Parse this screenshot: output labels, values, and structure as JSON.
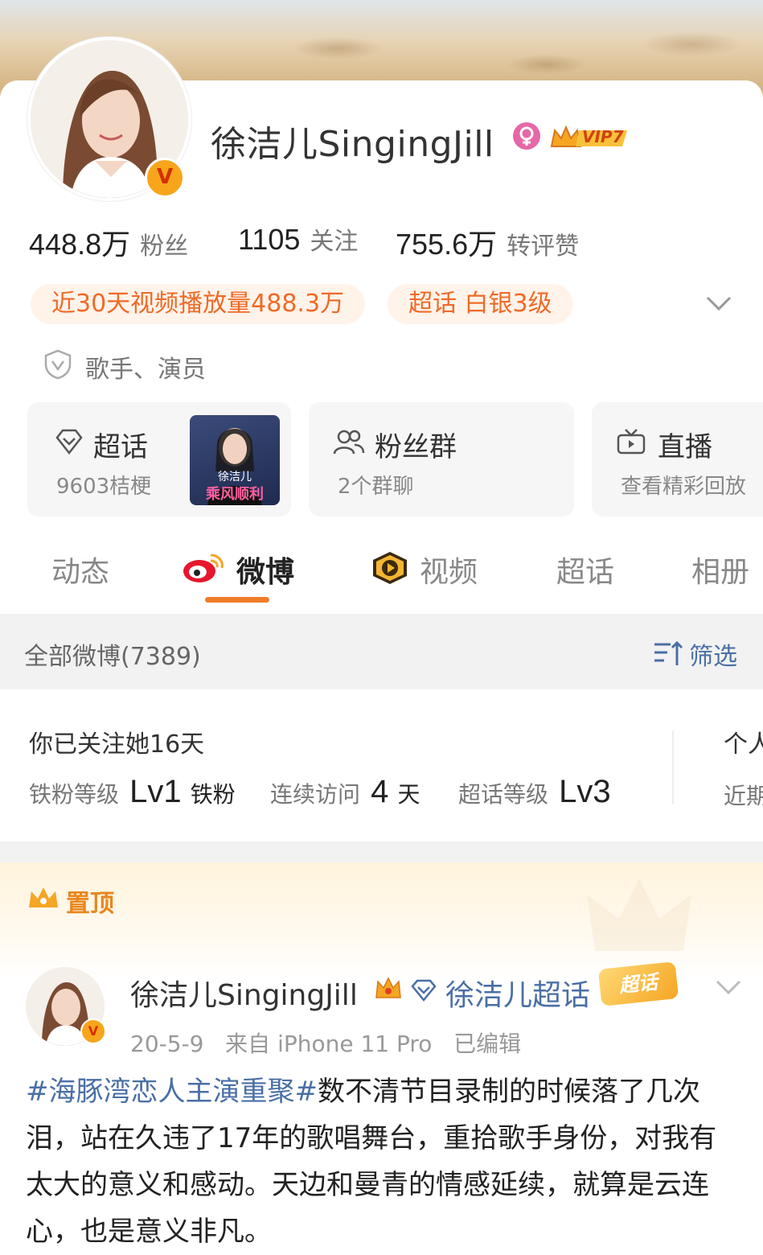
{
  "profile": {
    "name": "徐洁儿SingingJill",
    "vip_label": "VIP7",
    "stats": [
      {
        "value": "448.8万",
        "label": "粉丝"
      },
      {
        "value": "1105",
        "label": "关注"
      },
      {
        "value": "755.6万",
        "label": "转评赞"
      }
    ],
    "pills": [
      "近30天视频播放量488.3万",
      "超话 白银3级"
    ],
    "verified_text": "歌手、演员"
  },
  "entries": [
    {
      "title": "超话",
      "sub": "9603桔梗",
      "thumb_name": "徐洁儿",
      "thumb_caption": "乘风顺利"
    },
    {
      "title": "粉丝群",
      "sub": "2个群聊"
    },
    {
      "title": "直播",
      "sub": "查看精彩回放"
    }
  ],
  "tabs": [
    "动态",
    "微博",
    "视频",
    "超话",
    "相册"
  ],
  "filter": {
    "label": "全部微博(7389)",
    "button": "筛选"
  },
  "fans_card": {
    "title": "你已关注她16天",
    "items": [
      {
        "label": "铁粉等级",
        "value": "Lv1",
        "suffix": "铁粉"
      },
      {
        "label": "连续访问",
        "value": "4",
        "suffix": "天"
      },
      {
        "label": "超话等级",
        "value": "Lv3",
        "suffix": ""
      }
    ],
    "side_title": "个人",
    "side_sub": "近期"
  },
  "pinned_label": "置顶",
  "post": {
    "author": "徐洁儿SingingJill",
    "topic": "徐洁儿超话",
    "topic_badge": "超话",
    "meta": "20-5-9   来自 iPhone 11 Pro   已编辑",
    "hashtag": "#海豚湾恋人主演重聚#",
    "text": "数不清节目录制的时候落了几次泪，站在久违了17年的歌唱舞台，重拾歌手身份，对我有太大的意义和感动。天边和曼青的情感延续，就算是云连心，也是意义非凡。"
  },
  "colors": {
    "accent": "#ef6a27",
    "link": "#4a6fa5",
    "tab_indicator": "#f07c2a"
  }
}
